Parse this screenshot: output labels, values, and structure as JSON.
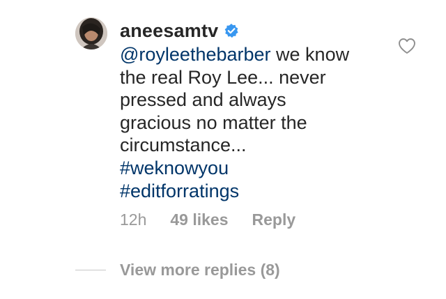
{
  "comment": {
    "username": "aneesamtv",
    "verified": true,
    "body_lines": [
      {
        "parts": [
          {
            "text": "@royleethebarber",
            "link": true
          },
          {
            "text": " we know",
            "link": false
          }
        ]
      },
      {
        "parts": [
          {
            "text": "the real Roy Lee... never",
            "link": false
          }
        ]
      },
      {
        "parts": [
          {
            "text": "pressed and always",
            "link": false
          }
        ]
      },
      {
        "parts": [
          {
            "text": "gracious no matter the",
            "link": false
          }
        ]
      },
      {
        "parts": [
          {
            "text": "circumstance...",
            "link": false
          }
        ]
      },
      {
        "parts": [
          {
            "text": "#weknowyou",
            "link": true
          }
        ]
      },
      {
        "parts": [
          {
            "text": "#editforratings",
            "link": true
          }
        ]
      }
    ],
    "time": "12h",
    "likes": "49 likes",
    "reply_label": "Reply",
    "view_more_replies": "View more replies (8)"
  },
  "icons": {
    "verified": "verified-badge-icon",
    "like": "heart-outline-icon"
  },
  "colors": {
    "text": "#262626",
    "link": "#003569",
    "meta": "#999999",
    "verified": "#3897f0"
  }
}
